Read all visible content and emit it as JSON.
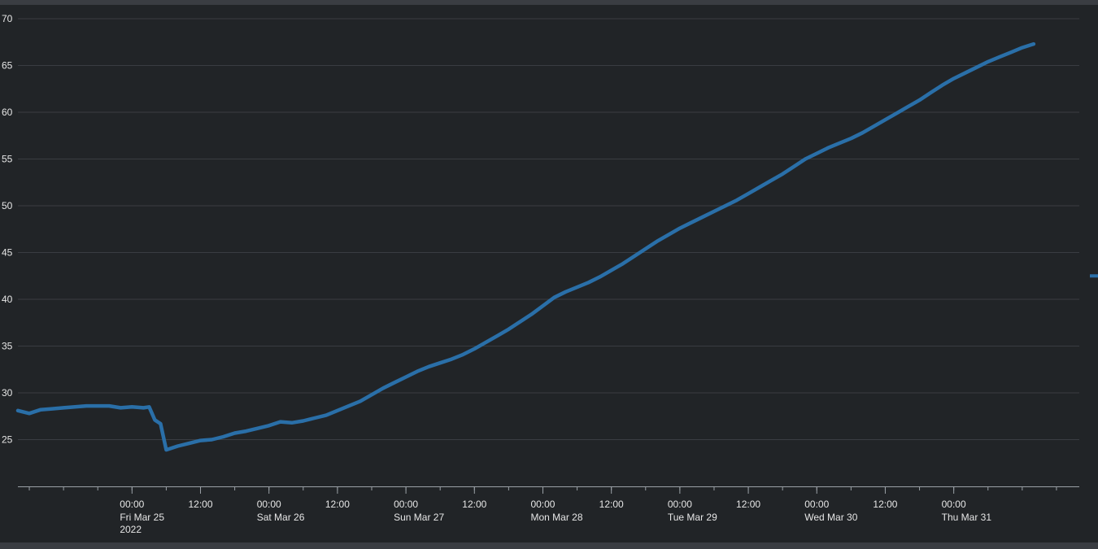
{
  "theme": {
    "background": "#212427",
    "frame": "#3a3d42",
    "grid": "#3a3d42",
    "axis": "#9aa0a6",
    "text": "#e6e6e6",
    "series_color": "#2a6fa8"
  },
  "chart_data": {
    "type": "line",
    "title": "",
    "xlabel": "",
    "ylabel": "",
    "grid": true,
    "legend": "none",
    "x_range": [
      "2022-03-24T04:00",
      "2022-03-31T22:00"
    ],
    "ylim": [
      20,
      70
    ],
    "y_ticks": [
      25,
      30,
      35,
      40,
      45,
      50,
      55,
      60,
      65,
      70
    ],
    "x_ticks": [
      {
        "t": "2022-03-25T00:00",
        "label": "00:00",
        "sub": "Fri Mar 25",
        "year": "2022"
      },
      {
        "t": "2022-03-25T12:00",
        "label": "12:00",
        "sub": "",
        "year": ""
      },
      {
        "t": "2022-03-26T00:00",
        "label": "00:00",
        "sub": "Sat Mar 26",
        "year": ""
      },
      {
        "t": "2022-03-26T12:00",
        "label": "12:00",
        "sub": "",
        "year": ""
      },
      {
        "t": "2022-03-27T00:00",
        "label": "00:00",
        "sub": "Sun Mar 27",
        "year": ""
      },
      {
        "t": "2022-03-27T12:00",
        "label": "12:00",
        "sub": "",
        "year": ""
      },
      {
        "t": "2022-03-28T00:00",
        "label": "00:00",
        "sub": "Mon Mar 28",
        "year": ""
      },
      {
        "t": "2022-03-28T12:00",
        "label": "12:00",
        "sub": "",
        "year": ""
      },
      {
        "t": "2022-03-29T00:00",
        "label": "00:00",
        "sub": "Tue Mar 29",
        "year": ""
      },
      {
        "t": "2022-03-29T12:00",
        "label": "12:00",
        "sub": "",
        "year": ""
      },
      {
        "t": "2022-03-30T00:00",
        "label": "00:00",
        "sub": "Wed Mar 30",
        "year": ""
      },
      {
        "t": "2022-03-30T12:00",
        "label": "12:00",
        "sub": "",
        "year": ""
      },
      {
        "t": "2022-03-31T00:00",
        "label": "00:00",
        "sub": "Thu Mar 31",
        "year": ""
      }
    ],
    "series": [
      {
        "points": [
          [
            "2022-03-24T04:00",
            28.1
          ],
          [
            "2022-03-24T06:00",
            27.8
          ],
          [
            "2022-03-24T08:00",
            28.2
          ],
          [
            "2022-03-24T10:00",
            28.3
          ],
          [
            "2022-03-24T12:00",
            28.4
          ],
          [
            "2022-03-24T14:00",
            28.5
          ],
          [
            "2022-03-24T16:00",
            28.6
          ],
          [
            "2022-03-24T18:00",
            28.6
          ],
          [
            "2022-03-24T20:00",
            28.6
          ],
          [
            "2022-03-24T22:00",
            28.4
          ],
          [
            "2022-03-25T00:00",
            28.5
          ],
          [
            "2022-03-25T02:00",
            28.4
          ],
          [
            "2022-03-25T03:00",
            28.5
          ],
          [
            "2022-03-25T04:00",
            27.1
          ],
          [
            "2022-03-25T05:00",
            26.7
          ],
          [
            "2022-03-25T06:00",
            23.9
          ],
          [
            "2022-03-25T08:00",
            24.3
          ],
          [
            "2022-03-25T10:00",
            24.6
          ],
          [
            "2022-03-25T12:00",
            24.9
          ],
          [
            "2022-03-25T14:00",
            25.0
          ],
          [
            "2022-03-25T16:00",
            25.3
          ],
          [
            "2022-03-25T18:00",
            25.7
          ],
          [
            "2022-03-25T20:00",
            25.9
          ],
          [
            "2022-03-25T22:00",
            26.2
          ],
          [
            "2022-03-26T00:00",
            26.5
          ],
          [
            "2022-03-26T02:00",
            26.9
          ],
          [
            "2022-03-26T04:00",
            26.8
          ],
          [
            "2022-03-26T06:00",
            27.0
          ],
          [
            "2022-03-26T08:00",
            27.3
          ],
          [
            "2022-03-26T10:00",
            27.6
          ],
          [
            "2022-03-26T12:00",
            28.1
          ],
          [
            "2022-03-26T14:00",
            28.6
          ],
          [
            "2022-03-26T16:00",
            29.1
          ],
          [
            "2022-03-26T18:00",
            29.8
          ],
          [
            "2022-03-26T20:00",
            30.5
          ],
          [
            "2022-03-26T22:00",
            31.1
          ],
          [
            "2022-03-27T00:00",
            31.7
          ],
          [
            "2022-03-27T02:00",
            32.3
          ],
          [
            "2022-03-27T04:00",
            32.8
          ],
          [
            "2022-03-27T06:00",
            33.2
          ],
          [
            "2022-03-27T08:00",
            33.6
          ],
          [
            "2022-03-27T10:00",
            34.1
          ],
          [
            "2022-03-27T12:00",
            34.7
          ],
          [
            "2022-03-27T14:00",
            35.4
          ],
          [
            "2022-03-27T16:00",
            36.1
          ],
          [
            "2022-03-27T18:00",
            36.8
          ],
          [
            "2022-03-27T20:00",
            37.6
          ],
          [
            "2022-03-27T22:00",
            38.4
          ],
          [
            "2022-03-28T00:00",
            39.3
          ],
          [
            "2022-03-28T02:00",
            40.2
          ],
          [
            "2022-03-28T04:00",
            40.8
          ],
          [
            "2022-03-28T06:00",
            41.3
          ],
          [
            "2022-03-28T08:00",
            41.8
          ],
          [
            "2022-03-28T10:00",
            42.4
          ],
          [
            "2022-03-28T12:00",
            43.1
          ],
          [
            "2022-03-28T14:00",
            43.8
          ],
          [
            "2022-03-28T16:00",
            44.6
          ],
          [
            "2022-03-28T18:00",
            45.4
          ],
          [
            "2022-03-28T20:00",
            46.2
          ],
          [
            "2022-03-28T22:00",
            46.9
          ],
          [
            "2022-03-29T00:00",
            47.6
          ],
          [
            "2022-03-29T02:00",
            48.2
          ],
          [
            "2022-03-29T04:00",
            48.8
          ],
          [
            "2022-03-29T06:00",
            49.4
          ],
          [
            "2022-03-29T08:00",
            50.0
          ],
          [
            "2022-03-29T10:00",
            50.6
          ],
          [
            "2022-03-29T12:00",
            51.3
          ],
          [
            "2022-03-29T14:00",
            52.0
          ],
          [
            "2022-03-29T16:00",
            52.7
          ],
          [
            "2022-03-29T18:00",
            53.4
          ],
          [
            "2022-03-29T20:00",
            54.2
          ],
          [
            "2022-03-29T22:00",
            55.0
          ],
          [
            "2022-03-30T00:00",
            55.6
          ],
          [
            "2022-03-30T02:00",
            56.2
          ],
          [
            "2022-03-30T04:00",
            56.7
          ],
          [
            "2022-03-30T06:00",
            57.2
          ],
          [
            "2022-03-30T08:00",
            57.8
          ],
          [
            "2022-03-30T10:00",
            58.5
          ],
          [
            "2022-03-30T12:00",
            59.2
          ],
          [
            "2022-03-30T14:00",
            59.9
          ],
          [
            "2022-03-30T16:00",
            60.6
          ],
          [
            "2022-03-30T18:00",
            61.3
          ],
          [
            "2022-03-30T20:00",
            62.1
          ],
          [
            "2022-03-30T22:00",
            62.9
          ],
          [
            "2022-03-31T00:00",
            63.6
          ],
          [
            "2022-03-31T02:00",
            64.2
          ],
          [
            "2022-03-31T04:00",
            64.8
          ],
          [
            "2022-03-31T06:00",
            65.4
          ],
          [
            "2022-03-31T08:00",
            65.9
          ],
          [
            "2022-03-31T10:00",
            66.4
          ],
          [
            "2022-03-31T12:00",
            66.9
          ],
          [
            "2022-03-31T14:00",
            67.3
          ]
        ]
      }
    ]
  }
}
